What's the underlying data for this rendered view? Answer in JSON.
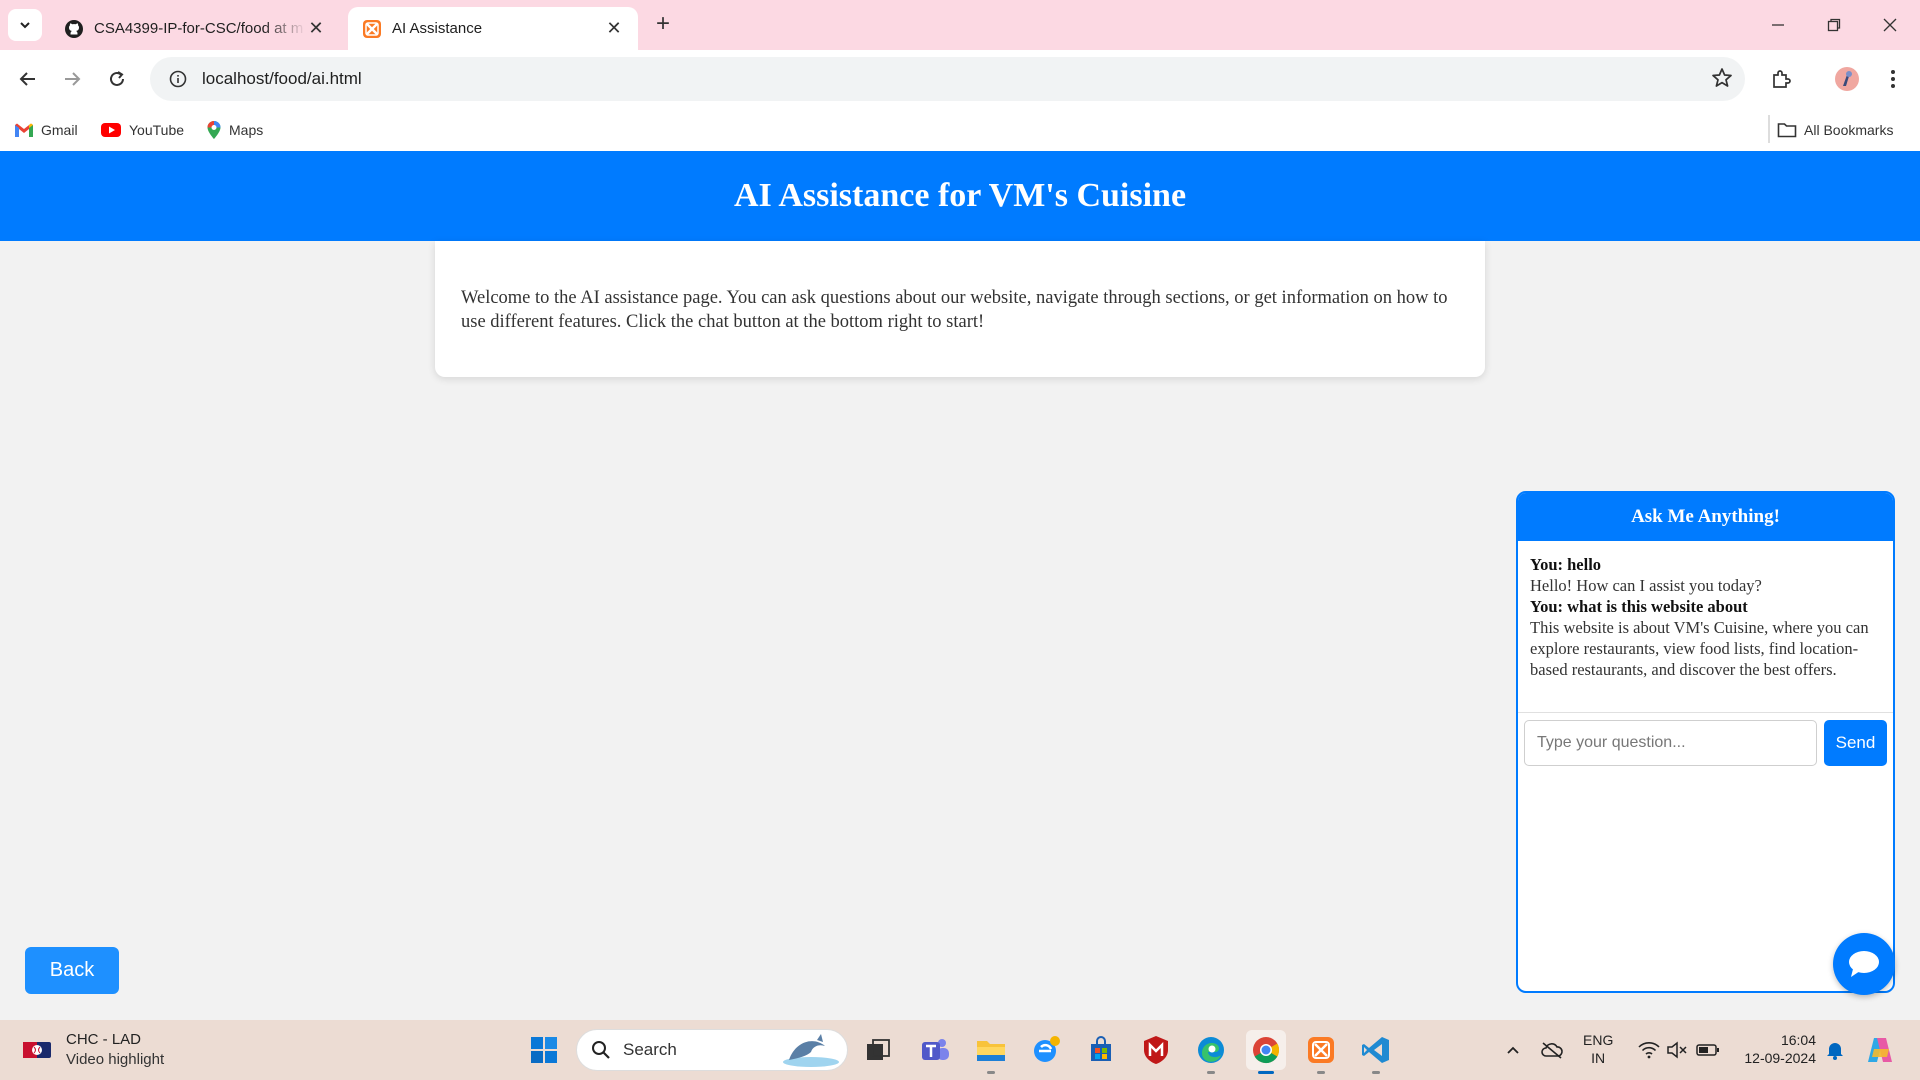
{
  "browser": {
    "tabs": [
      {
        "title": "CSA4399-IP-for-CSC/food at m",
        "favicon": "github-icon",
        "active": false
      },
      {
        "title": "AI Assistance",
        "favicon": "xampp-icon",
        "active": true
      }
    ],
    "url": "localhost/food/ai.html",
    "bookmarks": [
      {
        "label": "Gmail",
        "icon": "gmail-icon"
      },
      {
        "label": "YouTube",
        "icon": "youtube-icon"
      },
      {
        "label": "Maps",
        "icon": "maps-icon"
      }
    ],
    "all_bookmarks_label": "All Bookmarks"
  },
  "page": {
    "title": "AI Assistance for VM's Cuisine",
    "welcome_text": "Welcome to the AI assistance page. You can ask questions about our website, navigate through sections, or get information on how to use different features. Click the chat button at the bottom right to start!",
    "back_label": "Back"
  },
  "chat": {
    "header": "Ask Me Anything!",
    "messages": [
      {
        "user": "You: hello",
        "reply": "Hello! How can I assist you today?"
      },
      {
        "user": "You: what is this website about",
        "reply": "This website is about VM's Cuisine, where you can explore restaurants, view food lists, find location-based restaurants, and discover the best offers."
      }
    ],
    "input_placeholder": "Type your question...",
    "send_label": "Send"
  },
  "taskbar": {
    "widget_title": "CHC - LAD",
    "widget_subtitle": "Video highlight",
    "search_label": "Search",
    "lang_primary": "ENG",
    "lang_secondary": "IN",
    "time": "16:04",
    "date": "12-09-2024"
  },
  "colors": {
    "accent": "#007bff",
    "back_button": "#1e90ff",
    "tab_strip": "#fcd9e3",
    "taskbar": "#ecdcd3"
  }
}
